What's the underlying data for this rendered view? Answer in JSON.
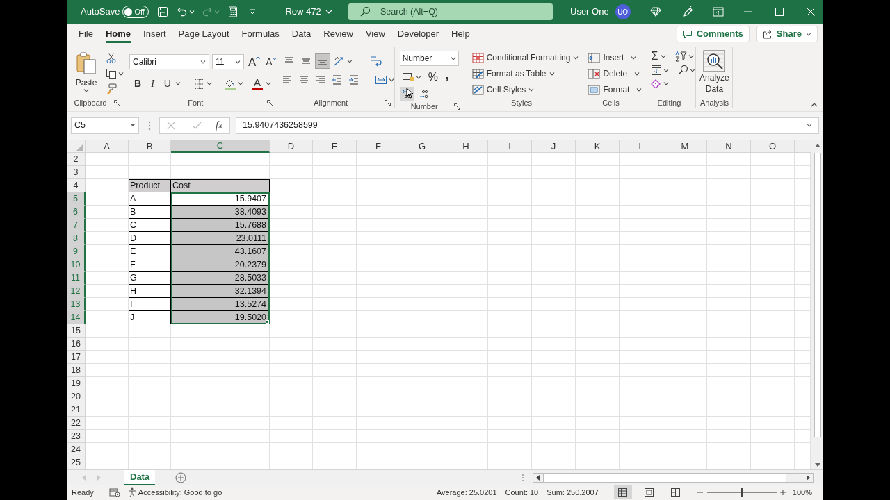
{
  "title_bar": {
    "autosave": {
      "label": "AutoSave",
      "on": false,
      "state_text": "Off"
    },
    "document_title": "Row 472",
    "search": {
      "placeholder": "Search (Alt+Q)"
    },
    "user_name": "User One",
    "avatar_initials": "UO"
  },
  "menu_tabs": [
    {
      "label": "File",
      "selected": false
    },
    {
      "label": "Home",
      "selected": true
    },
    {
      "label": "Insert",
      "selected": false
    },
    {
      "label": "Page Layout",
      "selected": false
    },
    {
      "label": "Formulas",
      "selected": false
    },
    {
      "label": "Data",
      "selected": false
    },
    {
      "label": "Review",
      "selected": false
    },
    {
      "label": "View",
      "selected": false
    },
    {
      "label": "Developer",
      "selected": false
    },
    {
      "label": "Help",
      "selected": false
    }
  ],
  "comments_button": "Comments",
  "share_button": "Share",
  "ribbon": {
    "clipboard": {
      "label": "Clipboard",
      "paste": "Paste"
    },
    "font": {
      "label": "Font",
      "font_name": "Calibri",
      "font_size": "11",
      "grow": "A",
      "shrink": "A",
      "bold": "B",
      "italic": "I",
      "underline": "U",
      "font_color": "A"
    },
    "alignment": {
      "label": "Alignment",
      "vertical": [
        {
          "kind": "top",
          "selected": false
        },
        {
          "kind": "middle",
          "selected": false
        },
        {
          "kind": "bottom",
          "selected": true
        }
      ]
    },
    "number": {
      "label": "Number",
      "format": "Number",
      "percent": "%",
      "comma": ",",
      "decimal_buttons": [
        {
          "kind": "decrease",
          "hovered": true
        },
        {
          "kind": "increase",
          "hovered": false
        }
      ]
    },
    "styles": {
      "label": "Styles",
      "items": [
        {
          "kind": "conditional",
          "label": "Conditional Formatting"
        },
        {
          "kind": "table",
          "label": "Format as Table"
        },
        {
          "kind": "cell",
          "label": "Cell Styles"
        }
      ]
    },
    "cells": {
      "label": "Cells",
      "items": [
        {
          "kind": "insert",
          "label": "Insert"
        },
        {
          "kind": "delete",
          "label": "Delete"
        },
        {
          "kind": "format",
          "label": "Format"
        }
      ]
    },
    "editing": {
      "label": "Editing",
      "sum": "Σ"
    },
    "analysis": {
      "label": "Analysis",
      "button": "Analyze Data"
    }
  },
  "formula_bar": {
    "name_box": "C5",
    "fx": "fx",
    "formula": "15.9407436258599"
  },
  "sheet": {
    "columns": [
      {
        "label": "A",
        "selected": false
      },
      {
        "label": "B",
        "selected": false
      },
      {
        "label": "C",
        "selected": true
      },
      {
        "label": "D",
        "selected": false
      },
      {
        "label": "E",
        "selected": false
      },
      {
        "label": "F",
        "selected": false
      },
      {
        "label": "G",
        "selected": false
      },
      {
        "label": "H",
        "selected": false
      },
      {
        "label": "I",
        "selected": false
      },
      {
        "label": "J",
        "selected": false
      },
      {
        "label": "K",
        "selected": false
      },
      {
        "label": "L",
        "selected": false
      },
      {
        "label": "M",
        "selected": false
      },
      {
        "label": "N",
        "selected": false
      },
      {
        "label": "O",
        "selected": false
      }
    ],
    "rows": [
      {
        "header": "2",
        "selected": false,
        "kind": "empty"
      },
      {
        "header": "3",
        "selected": false,
        "kind": "empty"
      },
      {
        "header": "4",
        "selected": false,
        "kind": "table-header",
        "product": "Product",
        "cost": "Cost"
      },
      {
        "header": "5",
        "selected": true,
        "kind": "table-row",
        "product": "A",
        "cost": "15.9407",
        "active": true
      },
      {
        "header": "6",
        "selected": true,
        "kind": "table-row",
        "product": "B",
        "cost": "38.4093",
        "active": false
      },
      {
        "header": "7",
        "selected": true,
        "kind": "table-row",
        "product": "C",
        "cost": "15.7688",
        "active": false
      },
      {
        "header": "8",
        "selected": true,
        "kind": "table-row",
        "product": "D",
        "cost": "23.0111",
        "active": false
      },
      {
        "header": "9",
        "selected": true,
        "kind": "table-row",
        "product": "E",
        "cost": "43.1607",
        "active": false
      },
      {
        "header": "10",
        "selected": true,
        "kind": "table-row",
        "product": "F",
        "cost": "20.2379",
        "active": false
      },
      {
        "header": "11",
        "selected": true,
        "kind": "table-row",
        "product": "G",
        "cost": "28.5033",
        "active": false
      },
      {
        "header": "12",
        "selected": true,
        "kind": "table-row",
        "product": "H",
        "cost": "32.1394",
        "active": false
      },
      {
        "header": "13",
        "selected": true,
        "kind": "table-row",
        "product": "I",
        "cost": "13.5274",
        "active": false
      },
      {
        "header": "14",
        "selected": true,
        "kind": "table-row",
        "product": "J",
        "cost": "19.5020",
        "active": false
      },
      {
        "header": "15",
        "selected": false,
        "kind": "empty"
      },
      {
        "header": "16",
        "selected": false,
        "kind": "empty"
      },
      {
        "header": "17",
        "selected": false,
        "kind": "empty"
      },
      {
        "header": "18",
        "selected": false,
        "kind": "empty"
      },
      {
        "header": "19",
        "selected": false,
        "kind": "empty"
      },
      {
        "header": "20",
        "selected": false,
        "kind": "empty"
      },
      {
        "header": "21",
        "selected": false,
        "kind": "empty"
      },
      {
        "header": "22",
        "selected": false,
        "kind": "empty"
      },
      {
        "header": "23",
        "selected": false,
        "kind": "empty"
      },
      {
        "header": "24",
        "selected": false,
        "kind": "empty"
      },
      {
        "header": "25",
        "selected": false,
        "kind": "empty"
      }
    ]
  },
  "sheet_tabs": [
    {
      "label": "Data",
      "selected": true
    }
  ],
  "status_bar": {
    "ready": "Ready",
    "accessibility": "Accessibility: Good to go",
    "stats": [
      "Average: 25.0201",
      "Count: 10",
      "Sum: 250.2007"
    ],
    "views": [
      {
        "kind": "normal",
        "selected": true
      },
      {
        "kind": "page-layout",
        "selected": false
      },
      {
        "kind": "page-break",
        "selected": false
      }
    ],
    "zoom": {
      "level": 0.5,
      "label": "100%"
    }
  }
}
